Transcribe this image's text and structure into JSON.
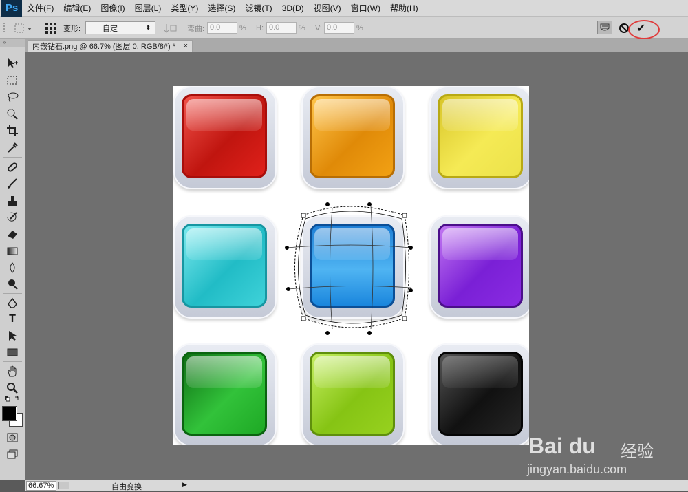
{
  "app": {
    "logo": "Ps"
  },
  "menu": [
    "文件(F)",
    "编辑(E)",
    "图像(I)",
    "图层(L)",
    "类型(Y)",
    "选择(S)",
    "滤镜(T)",
    "3D(D)",
    "视图(V)",
    "窗口(W)",
    "帮助(H)"
  ],
  "options": {
    "warp_label": "变形:",
    "warp_value": "自定",
    "bend_label": "弯曲:",
    "bend_value": "0.0",
    "bend_unit": "%",
    "h_label": "H:",
    "h_value": "0.0",
    "h_unit": "%",
    "v_label": "V:",
    "v_value": "0.0",
    "v_unit": "%",
    "cancel_icon": "cancel-transform-icon",
    "commit_icon": "commit-check-icon",
    "commit_glyph": "✔"
  },
  "document": {
    "tab_title": "内嵌钻石.png @ 66.7% (图层 0, RGB/8#) *",
    "close": "×"
  },
  "status": {
    "zoom": "66.67%",
    "text": "自由变换",
    "arrow": "▶"
  },
  "watermark": {
    "logo": "Bai du",
    "brand": "经验",
    "url": "jingyan.baidu.com"
  },
  "canvas": {
    "buttons": [
      {
        "name": "red",
        "color": "#e0211b",
        "edge": "#a80e0b"
      },
      {
        "name": "orange",
        "color": "#f2a114",
        "edge": "#b86e04"
      },
      {
        "name": "yellow",
        "color": "#f1e13c",
        "edge": "#b8a914"
      },
      {
        "name": "cyan",
        "color": "#3fd2d9",
        "edge": "#1796a1"
      },
      {
        "name": "blue",
        "color": "#1a86dd",
        "edge": "#0b4f97"
      },
      {
        "name": "purple",
        "color": "#8a2be2",
        "edge": "#4b0f8a"
      },
      {
        "name": "green",
        "color": "#1ea925",
        "edge": "#0b6410"
      },
      {
        "name": "lime",
        "color": "#97d11f",
        "edge": "#5f8f0c"
      },
      {
        "name": "black",
        "color": "#252525",
        "edge": "#050505"
      }
    ]
  },
  "colors": {
    "foreground": "#000000",
    "background": "#ffffff",
    "highlight": "#e03a3a"
  }
}
